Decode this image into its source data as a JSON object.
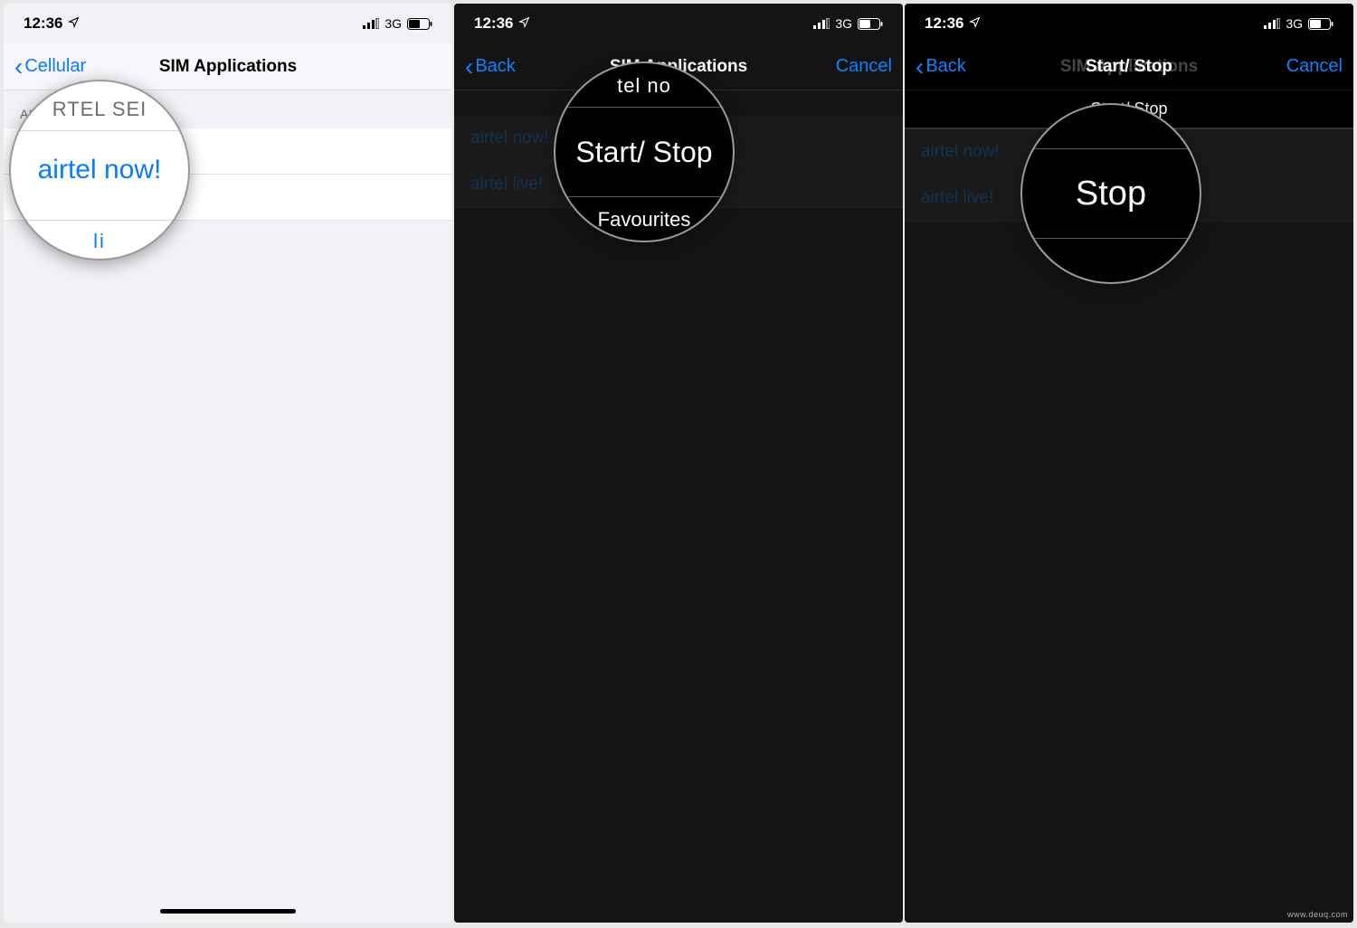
{
  "status": {
    "time": "12:36",
    "network": "3G"
  },
  "screen1": {
    "back_label": "Cellular",
    "title": "SIM Applications",
    "section_header": "AIRTEL SERVICES",
    "rows": [
      "airtel now!",
      "airtel live!"
    ],
    "magnifier": {
      "header_fragment": "RTEL SEI",
      "main": "airtel now!",
      "below_fragment": "li"
    }
  },
  "screen2": {
    "back_label": "Back",
    "title": "SIM Applications",
    "cancel": "Cancel",
    "rows": [
      "airtel now!",
      "airtel live!"
    ],
    "popup": {
      "title_fragment": "tel no",
      "rows": [
        "Start/ Stop",
        "Favourites"
      ]
    },
    "magnifier": {
      "top_fragment": "tel no",
      "main": "Start/ Stop",
      "bottom": "Favourites"
    }
  },
  "screen3": {
    "back_label": "Back",
    "title_overlay": "Start/ Stop",
    "title_bg": "SIM Applications",
    "cancel": "Cancel",
    "rows": [
      "airtel now!",
      "airtel live!"
    ],
    "popup": {
      "header": "Start/ Stop",
      "rows": [
        "Stop"
      ]
    },
    "magnifier": {
      "main": "Stop"
    }
  },
  "watermark": "www.deuq.com"
}
